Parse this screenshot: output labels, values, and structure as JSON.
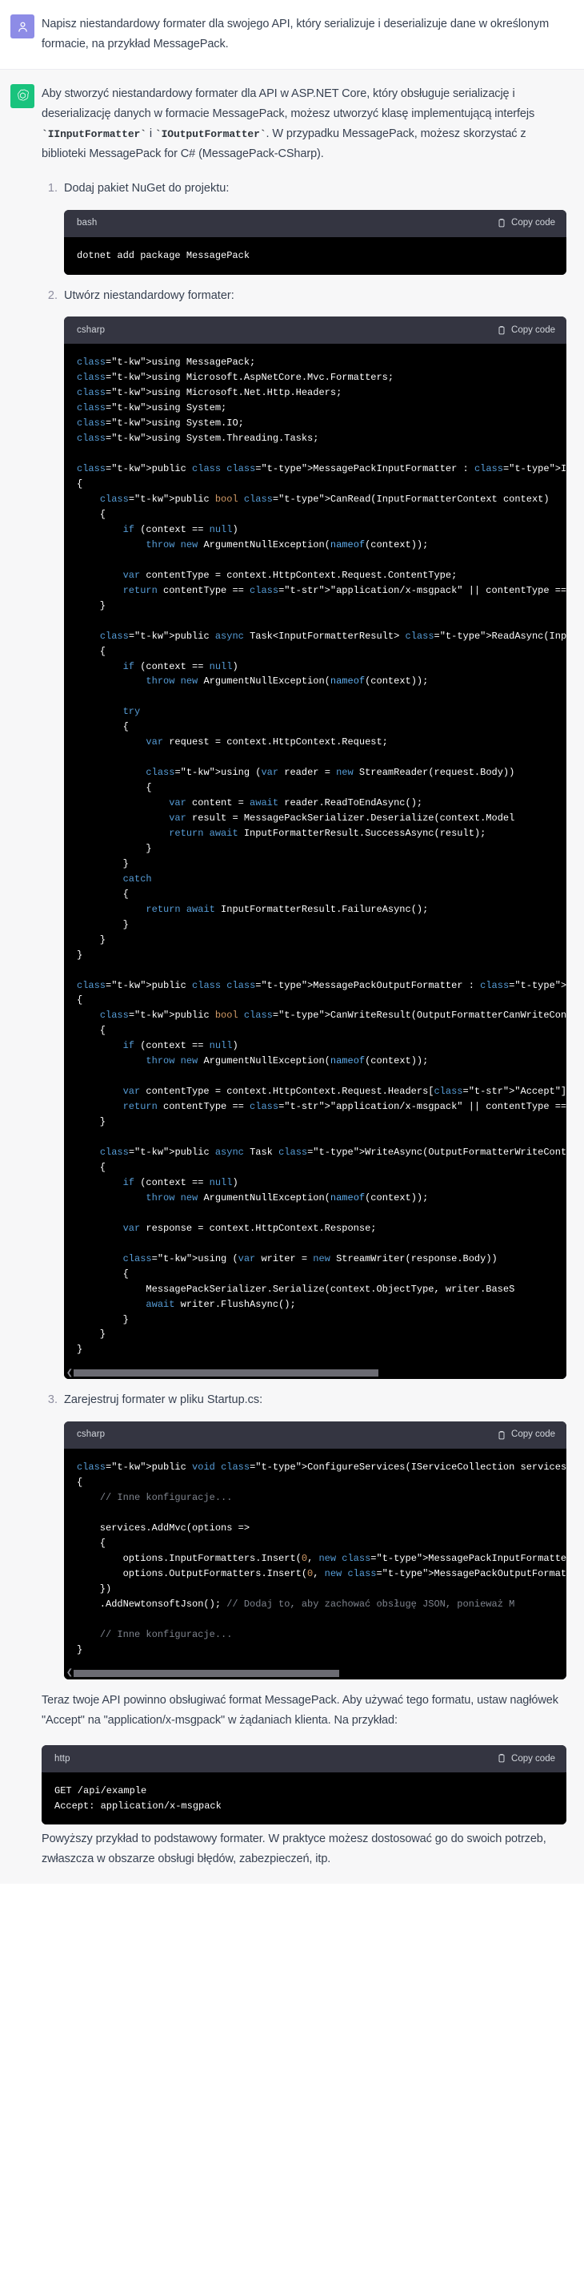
{
  "conversation": {
    "user_turn": {
      "avatar_icon": "user-person-icon",
      "text": "Napisz niestandardowy formater dla swojego API, który serializuje i deserializuje dane w określonym formacie, na przykład MessagePack."
    },
    "assistant_turn": {
      "avatar_icon": "openai-logo-icon",
      "intro": {
        "part1": "Aby stworzyć niestandardowy formater dla API w ASP.NET Core, który obsługuje serializację i deserializację danych w formacie MessagePack, możesz utworzyć klasę implementującą interfejs ",
        "code1": "`IInputFormatter`",
        "mid": " i ",
        "code2": "`IOutputFormatter`",
        "part2": ". W przypadku MessagePack, możesz skorzystać z biblioteki MessagePack for C# (MessagePack-CSharp)."
      },
      "steps": [
        {
          "label": "Dodaj pakiet NuGet do projektu:",
          "code": {
            "lang": "bash",
            "copy_label": "Copy code",
            "copy_icon": "clipboard-icon",
            "has_scrollbar": false,
            "body": "dotnet add package MessagePack"
          }
        },
        {
          "label": "Utwórz niestandardowy formater:",
          "code": {
            "lang": "csharp",
            "copy_label": "Copy code",
            "copy_icon": "clipboard-icon",
            "has_scrollbar": true,
            "scroll_thumb_percent": 62,
            "body": "using MessagePack;\nusing Microsoft.AspNetCore.Mvc.Formatters;\nusing Microsoft.Net.Http.Headers;\nusing System;\nusing System.IO;\nusing System.Threading.Tasks;\n\npublic class MessagePackInputFormatter : IInputFormatter\n{\n    public bool CanRead(InputFormatterContext context)\n    {\n        if (context == null)\n            throw new ArgumentNullException(nameof(context));\n\n        var contentType = context.HttpContext.Request.ContentType;\n        return contentType == \"application/x-msgpack\" || contentType == \"app\n    }\n\n    public async Task<InputFormatterResult> ReadAsync(InputFormatterContext\n    {\n        if (context == null)\n            throw new ArgumentNullException(nameof(context));\n\n        try\n        {\n            var request = context.HttpContext.Request;\n\n            using (var reader = new StreamReader(request.Body))\n            {\n                var content = await reader.ReadToEndAsync();\n                var result = MessagePackSerializer.Deserialize(context.Model\n                return await InputFormatterResult.SuccessAsync(result);\n            }\n        }\n        catch\n        {\n            return await InputFormatterResult.FailureAsync();\n        }\n    }\n}\n\npublic class MessagePackOutputFormatter : IOutputFormatter\n{\n    public bool CanWriteResult(OutputFormatterCanWriteContext context)\n    {\n        if (context == null)\n            throw new ArgumentNullException(nameof(context));\n\n        var contentType = context.HttpContext.Request.Headers[\"Accept\"];\n        return contentType == \"application/x-msgpack\" || contentType == \"app\n    }\n\n    public async Task WriteAsync(OutputFormatterWriteContext context)\n    {\n        if (context == null)\n            throw new ArgumentNullException(nameof(context));\n\n        var response = context.HttpContext.Response;\n\n        using (var writer = new StreamWriter(response.Body))\n        {\n            MessagePackSerializer.Serialize(context.ObjectType, writer.BaseS\n            await writer.FlushAsync();\n        }\n    }\n}"
          }
        },
        {
          "label": "Zarejestruj formater w pliku Startup.cs:",
          "code": {
            "lang": "csharp",
            "copy_label": "Copy code",
            "copy_icon": "clipboard-icon",
            "has_scrollbar": true,
            "scroll_thumb_percent": 54,
            "body": "public void ConfigureServices(IServiceCollection services)\n{\n    // Inne konfiguracje...\n\n    services.AddMvc(options =>\n    {\n        options.InputFormatters.Insert(0, new MessagePackInputFormatter());\n        options.OutputFormatters.Insert(0, new MessagePackOutputFormatter())\n    })\n    .AddNewtonsoftJson(); // Dodaj to, aby zachować obsługę JSON, ponieważ M\n\n    // Inne konfiguracje...\n}"
          }
        }
      ],
      "after_steps": {
        "para1": "Teraz twoje API powinno obsługiwać format MessagePack. Aby używać tego formatu, ustaw nagłówek \"Accept\" na \"application/x-msgpack\" w żądaniach klienta. Na przykład:",
        "http_code": {
          "lang": "http",
          "copy_label": "Copy code",
          "copy_icon": "clipboard-icon",
          "has_scrollbar": false,
          "body": "GET /api/example\nAccept: application/x-msgpack"
        },
        "para2": "Powyższy przykład to podstawowy formater. W praktyce możesz dostosować go do swoich potrzeb, zwłaszcza w obszarze obsługi błędów, zabezpieczeń, itp."
      }
    }
  },
  "colors": {
    "user_avatar": "#8d8ce6",
    "assistant_avatar": "#19c37d",
    "assistant_bg": "#f7f7f8",
    "code_header_bg": "#343541",
    "code_body_bg": "#000000"
  }
}
